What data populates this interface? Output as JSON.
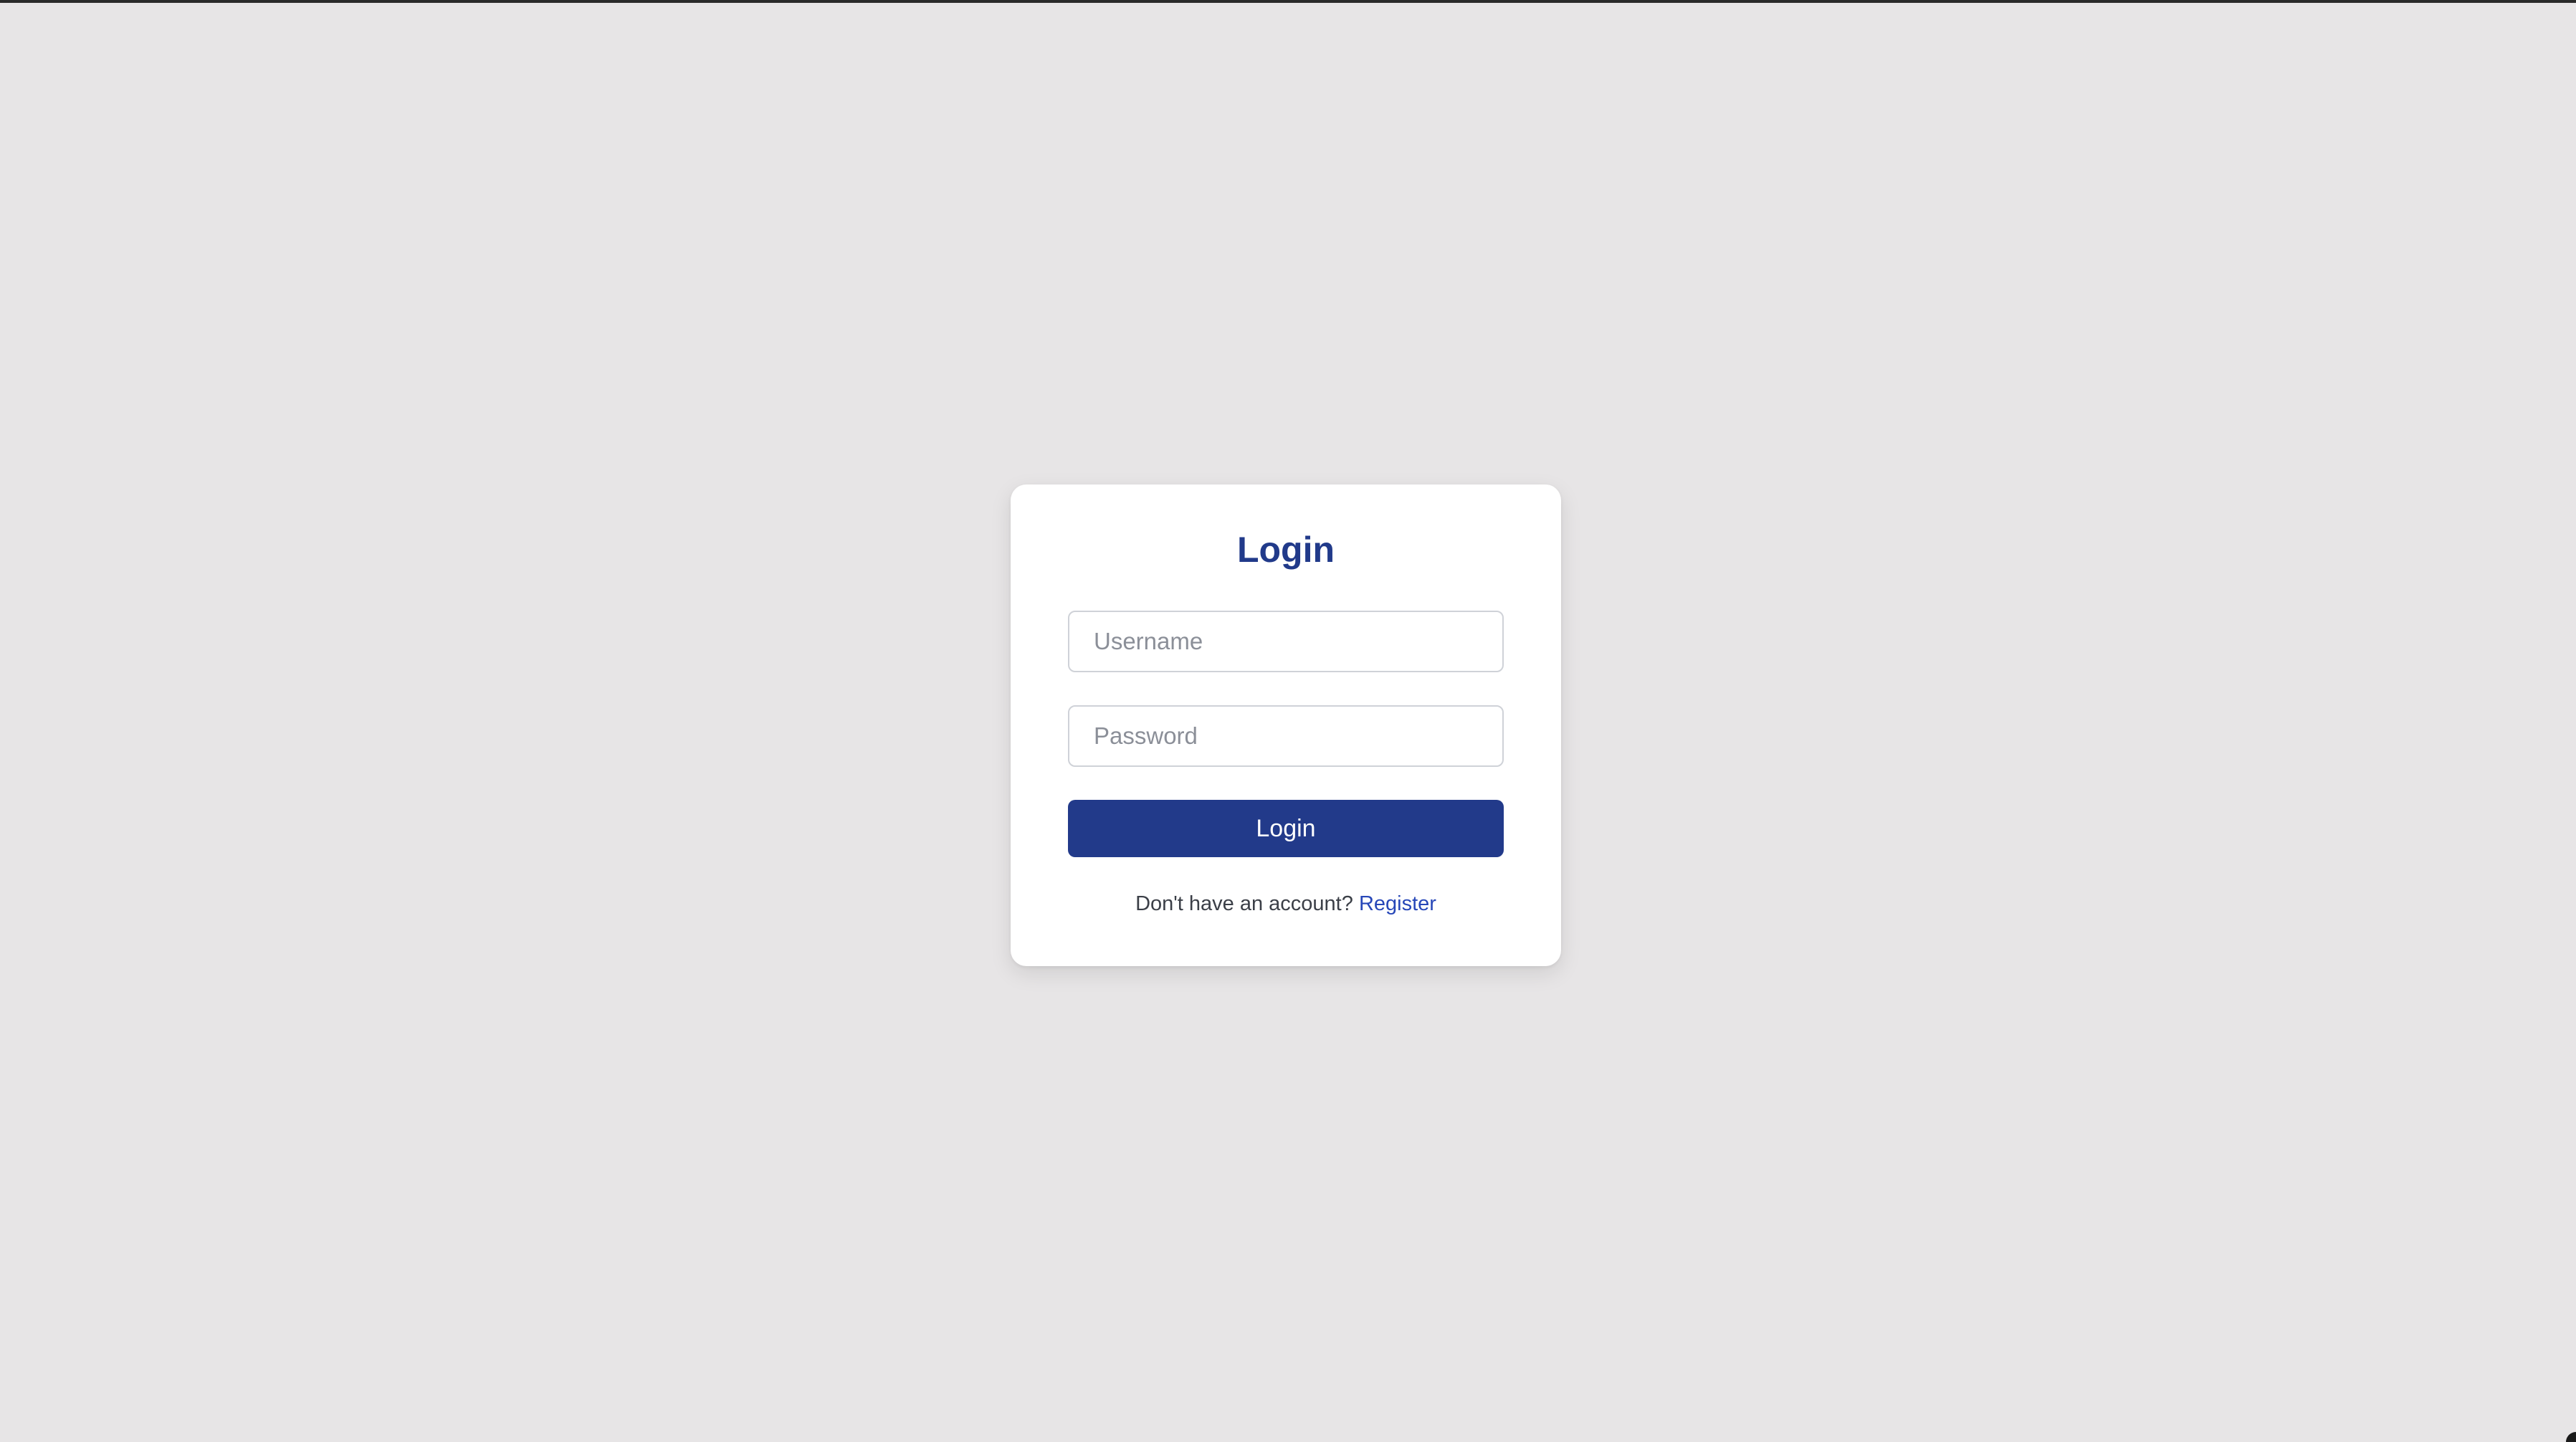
{
  "login_card": {
    "title": "Login",
    "username_placeholder": "Username",
    "username_value": "",
    "password_placeholder": "Password",
    "password_value": "",
    "submit_label": "Login",
    "register_prompt": "Don't have an account?",
    "register_link_label": "Register"
  },
  "colors": {
    "background": "#e7e5e6",
    "card": "#ffffff",
    "accent": "#223a8a",
    "link": "#2747b8"
  }
}
